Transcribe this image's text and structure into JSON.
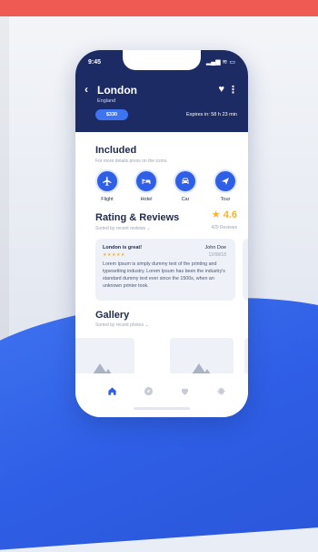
{
  "status": {
    "time": "9:45",
    "icons": "signal wifi battery"
  },
  "header": {
    "title": "London",
    "subtitle": "England",
    "price": "$330",
    "expires": "Expires in: 58 h 23 min"
  },
  "included": {
    "title": "Included",
    "subtitle": "For more details press on the icons.",
    "items": [
      {
        "label": "Flight",
        "icon": "plane-icon"
      },
      {
        "label": "Hotel",
        "icon": "bed-icon"
      },
      {
        "label": "Car",
        "icon": "car-icon"
      },
      {
        "label": "Tour",
        "icon": "tour-icon"
      }
    ]
  },
  "ratings": {
    "title": "Rating & Reviews",
    "sort": "Sorted by recent reviews",
    "score": "★ 4.6",
    "count": "429 Reviews"
  },
  "review": {
    "title": "London is great!",
    "author": "John Doe",
    "stars": "★★★★★",
    "date": "12/08/18",
    "body": "Lorem Ipsum is simply dummy text of the printing and typesetting industry. Lorem Ipsum has been the industry's standard dummy text ever since the 1500s, when an unknown printer took."
  },
  "gallery": {
    "title": "Gallery",
    "sort": "Sorted by recent photos"
  },
  "colors": {
    "header": "#1c2b63",
    "accent": "#2f5fe6",
    "star": "#f3b531",
    "top_band": "#ef5a52"
  }
}
